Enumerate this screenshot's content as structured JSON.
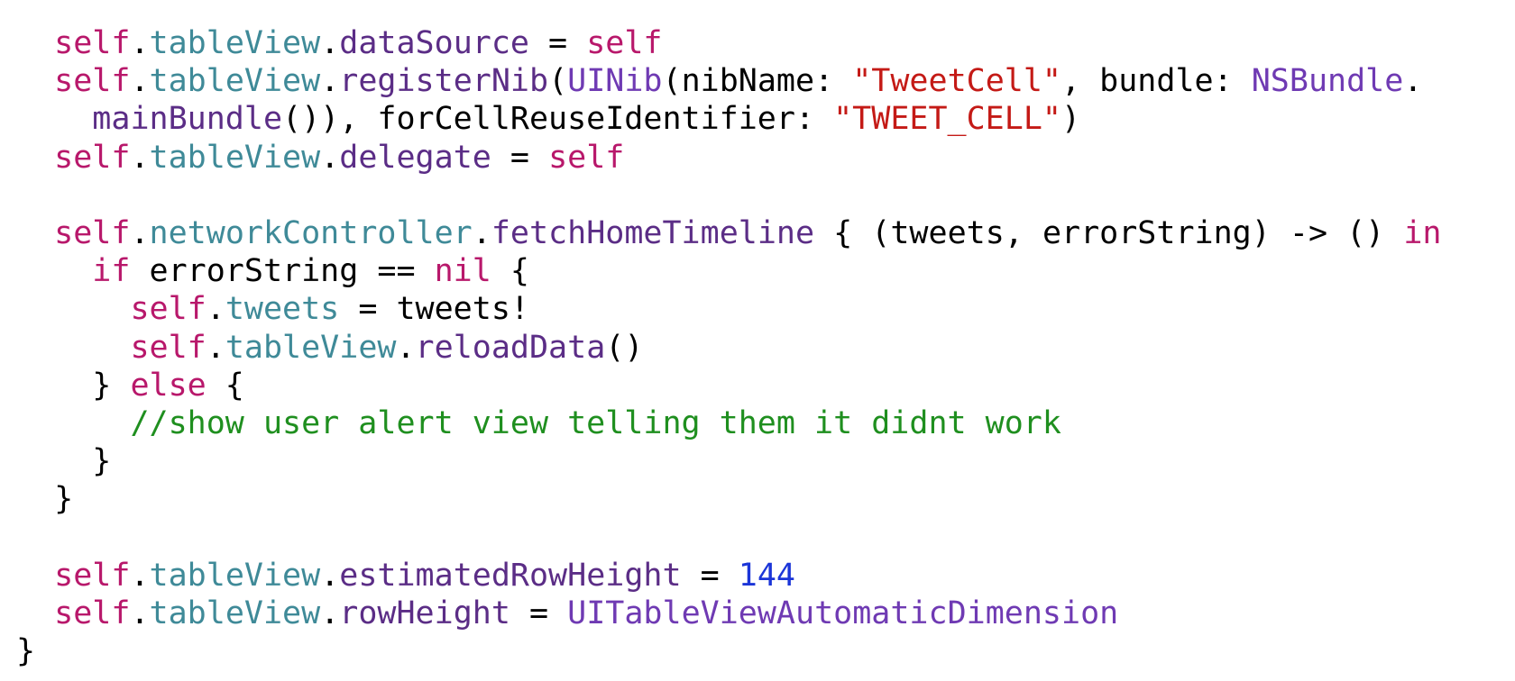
{
  "code": {
    "lines": [
      {
        "tokens": [
          {
            "text": "  ",
            "kind": "plain"
          },
          {
            "text": "self",
            "kind": "kw"
          },
          {
            "text": ".",
            "kind": "plain"
          },
          {
            "text": "tableView",
            "kind": "prop"
          },
          {
            "text": ".",
            "kind": "plain"
          },
          {
            "text": "dataSource",
            "kind": "meth"
          },
          {
            "text": " = ",
            "kind": "plain"
          },
          {
            "text": "self",
            "kind": "kw"
          }
        ]
      },
      {
        "tokens": [
          {
            "text": "  ",
            "kind": "plain"
          },
          {
            "text": "self",
            "kind": "kw"
          },
          {
            "text": ".",
            "kind": "plain"
          },
          {
            "text": "tableView",
            "kind": "prop"
          },
          {
            "text": ".",
            "kind": "plain"
          },
          {
            "text": "registerNib",
            "kind": "meth"
          },
          {
            "text": "(",
            "kind": "plain"
          },
          {
            "text": "UINib",
            "kind": "type"
          },
          {
            "text": "(nibName: ",
            "kind": "plain"
          },
          {
            "text": "\"TweetCell\"",
            "kind": "str"
          },
          {
            "text": ", bundle: ",
            "kind": "plain"
          },
          {
            "text": "NSBundle",
            "kind": "type"
          },
          {
            "text": ".",
            "kind": "plain"
          }
        ]
      },
      {
        "tokens": [
          {
            "text": "    ",
            "kind": "plain"
          },
          {
            "text": "mainBundle",
            "kind": "meth"
          },
          {
            "text": "()), forCellReuseIdentifier: ",
            "kind": "plain"
          },
          {
            "text": "\"TWEET_CELL\"",
            "kind": "str"
          },
          {
            "text": ")",
            "kind": "plain"
          }
        ]
      },
      {
        "tokens": [
          {
            "text": "  ",
            "kind": "plain"
          },
          {
            "text": "self",
            "kind": "kw"
          },
          {
            "text": ".",
            "kind": "plain"
          },
          {
            "text": "tableView",
            "kind": "prop"
          },
          {
            "text": ".",
            "kind": "plain"
          },
          {
            "text": "delegate",
            "kind": "meth"
          },
          {
            "text": " = ",
            "kind": "plain"
          },
          {
            "text": "self",
            "kind": "kw"
          }
        ]
      },
      {
        "tokens": [
          {
            "text": "",
            "kind": "plain"
          }
        ]
      },
      {
        "tokens": [
          {
            "text": "  ",
            "kind": "plain"
          },
          {
            "text": "self",
            "kind": "kw"
          },
          {
            "text": ".",
            "kind": "plain"
          },
          {
            "text": "networkController",
            "kind": "prop"
          },
          {
            "text": ".",
            "kind": "plain"
          },
          {
            "text": "fetchHomeTimeline",
            "kind": "meth"
          },
          {
            "text": " { (tweets, errorString) -> () ",
            "kind": "plain"
          },
          {
            "text": "in",
            "kind": "kw"
          }
        ]
      },
      {
        "tokens": [
          {
            "text": "    ",
            "kind": "plain"
          },
          {
            "text": "if",
            "kind": "kw"
          },
          {
            "text": " errorString == ",
            "kind": "plain"
          },
          {
            "text": "nil",
            "kind": "kw"
          },
          {
            "text": " {",
            "kind": "plain"
          }
        ]
      },
      {
        "tokens": [
          {
            "text": "      ",
            "kind": "plain"
          },
          {
            "text": "self",
            "kind": "kw"
          },
          {
            "text": ".",
            "kind": "plain"
          },
          {
            "text": "tweets",
            "kind": "prop"
          },
          {
            "text": " = tweets!",
            "kind": "plain"
          }
        ]
      },
      {
        "tokens": [
          {
            "text": "      ",
            "kind": "plain"
          },
          {
            "text": "self",
            "kind": "kw"
          },
          {
            "text": ".",
            "kind": "plain"
          },
          {
            "text": "tableView",
            "kind": "prop"
          },
          {
            "text": ".",
            "kind": "plain"
          },
          {
            "text": "reloadData",
            "kind": "meth"
          },
          {
            "text": "()",
            "kind": "plain"
          }
        ]
      },
      {
        "tokens": [
          {
            "text": "    } ",
            "kind": "plain"
          },
          {
            "text": "else",
            "kind": "kw"
          },
          {
            "text": " {",
            "kind": "plain"
          }
        ]
      },
      {
        "tokens": [
          {
            "text": "      ",
            "kind": "plain"
          },
          {
            "text": "//show user alert view telling them it didnt work",
            "kind": "cmt"
          }
        ]
      },
      {
        "tokens": [
          {
            "text": "    }",
            "kind": "plain"
          }
        ]
      },
      {
        "tokens": [
          {
            "text": "  }",
            "kind": "plain"
          }
        ]
      },
      {
        "tokens": [
          {
            "text": "",
            "kind": "plain"
          }
        ]
      },
      {
        "tokens": [
          {
            "text": "  ",
            "kind": "plain"
          },
          {
            "text": "self",
            "kind": "kw"
          },
          {
            "text": ".",
            "kind": "plain"
          },
          {
            "text": "tableView",
            "kind": "prop"
          },
          {
            "text": ".",
            "kind": "plain"
          },
          {
            "text": "estimatedRowHeight",
            "kind": "meth"
          },
          {
            "text": " = ",
            "kind": "plain"
          },
          {
            "text": "144",
            "kind": "num"
          }
        ]
      },
      {
        "tokens": [
          {
            "text": "  ",
            "kind": "plain"
          },
          {
            "text": "self",
            "kind": "kw"
          },
          {
            "text": ".",
            "kind": "plain"
          },
          {
            "text": "tableView",
            "kind": "prop"
          },
          {
            "text": ".",
            "kind": "plain"
          },
          {
            "text": "rowHeight",
            "kind": "meth"
          },
          {
            "text": " = ",
            "kind": "plain"
          },
          {
            "text": "UITableViewAutomaticDimension",
            "kind": "type"
          }
        ]
      },
      {
        "tokens": [
          {
            "text": "}",
            "kind": "plain"
          }
        ]
      }
    ]
  },
  "colors": {
    "background": "#ffffff",
    "keyword": "#b8186b",
    "property": "#3f8a98",
    "method": "#5b2d86",
    "string": "#c41a16",
    "type": "#6f3ab3",
    "number": "#1b35d8",
    "comment": "#1f8f1f",
    "plain": "#000000"
  }
}
